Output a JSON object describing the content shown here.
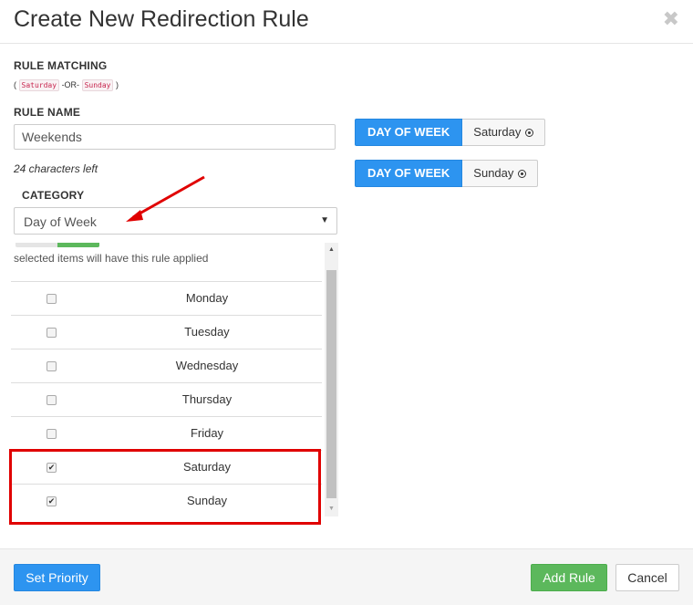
{
  "dialog": {
    "title": "Create New Redirection Rule",
    "close_glyph": "✖"
  },
  "rule_matching": {
    "label": "RULE MATCHING",
    "open_paren": "(",
    "close_paren": ")",
    "term1": "Saturday",
    "operator": "-OR-",
    "term2": "Sunday"
  },
  "rule_name": {
    "label": "RULE NAME",
    "value": "Weekends",
    "chars_left": "24 characters left"
  },
  "category": {
    "label": "CATEGORY",
    "selected": "Day of Week",
    "caret": "▼"
  },
  "days": {
    "hint": "selected items will have this rule applied",
    "items": [
      {
        "label": "Monday",
        "checked": false
      },
      {
        "label": "Tuesday",
        "checked": false
      },
      {
        "label": "Wednesday",
        "checked": false
      },
      {
        "label": "Thursday",
        "checked": false
      },
      {
        "label": "Friday",
        "checked": false
      },
      {
        "label": "Saturday",
        "checked": true
      },
      {
        "label": "Sunday",
        "checked": true
      }
    ]
  },
  "tags": [
    {
      "key": "DAY OF WEEK",
      "value": "Saturday"
    },
    {
      "key": "DAY OF WEEK",
      "value": "Sunday"
    }
  ],
  "footer": {
    "set_priority": "Set Priority",
    "add_rule": "Add Rule",
    "cancel": "Cancel"
  },
  "colors": {
    "primary": "#2d94f0",
    "success": "#5cb85c",
    "highlight": "#e00000",
    "annotation_arrow": "#e00000"
  },
  "icons": {
    "close": "close-icon",
    "remove": "remove-circle-icon",
    "caret": "chevron-down-icon",
    "scroll_up": "scroll-up-arrow-icon",
    "scroll_down": "scroll-down-arrow-icon"
  }
}
